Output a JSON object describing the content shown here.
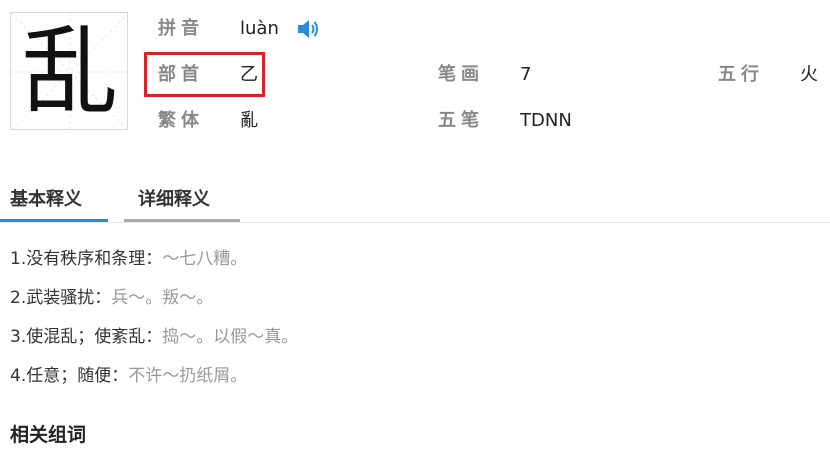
{
  "character": "乱",
  "info": {
    "pinyin_label": "拼音",
    "pinyin_value": "luàn",
    "radical_label": "部首",
    "radical_value": "乙",
    "traditional_label": "繁体",
    "traditional_value": "亂",
    "strokes_label": "笔画",
    "strokes_value": "7",
    "wubi_label": "五笔",
    "wubi_value": "TDNN",
    "wuxing_label": "五行",
    "wuxing_value": "火"
  },
  "tabs": [
    {
      "label": "基本释义",
      "active": true
    },
    {
      "label": "详细释义",
      "active": false
    }
  ],
  "definitions": [
    {
      "text": "1.没有秩序和条理：",
      "example": "～七八糟。"
    },
    {
      "text": "2.武装骚扰：",
      "example": "兵～。叛～。"
    },
    {
      "text": "3.使混乱；使紊乱：",
      "example": "捣～。以假～真。"
    },
    {
      "text": "4.任意；随便：",
      "example": "不许～扔纸屑。"
    }
  ],
  "related_title": "相关组词",
  "colors": {
    "active_tab": "#2a8bd6",
    "highlight_box": "#d8232a",
    "audio_icon": "#2a8bd6"
  },
  "icons": {
    "audio": "speaker-icon"
  }
}
